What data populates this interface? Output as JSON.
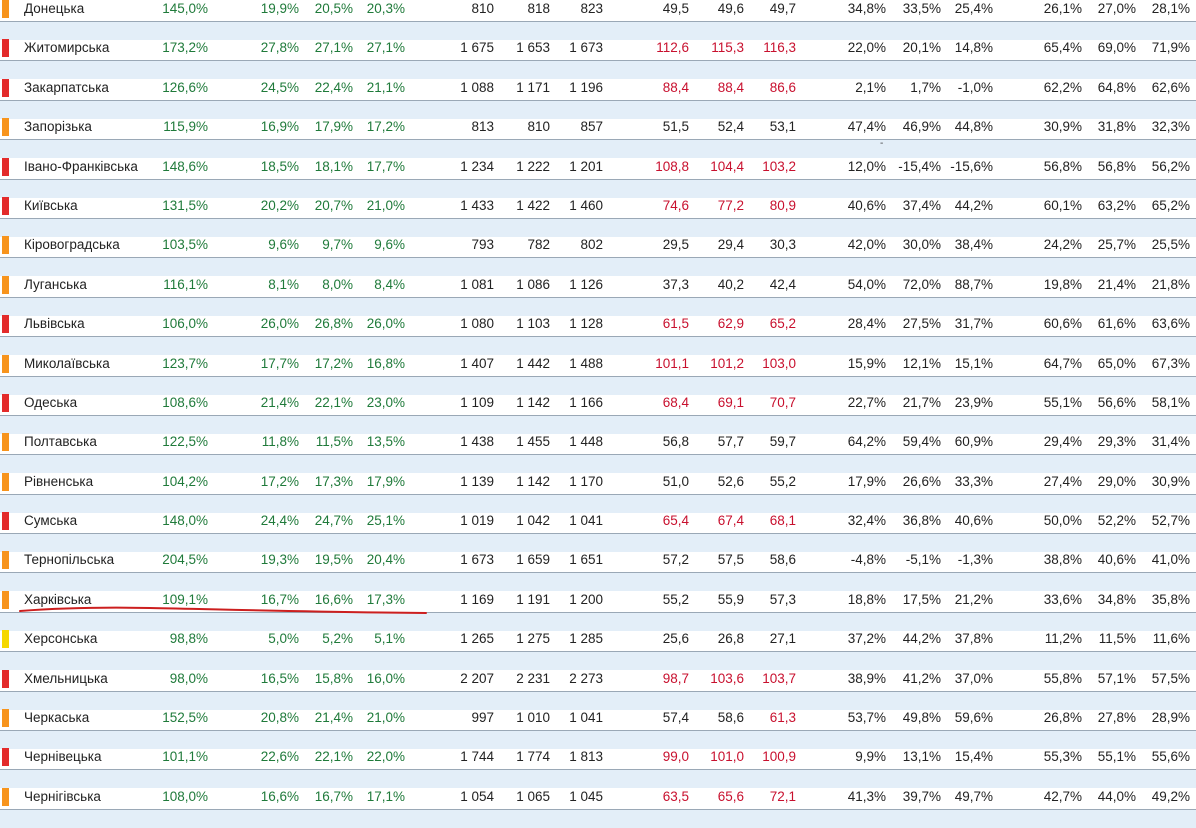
{
  "colors": {
    "orange": "#f7941d",
    "red": "#e32b2b",
    "yellow": "#f5d800",
    "green_text": "#1f7a3a",
    "red_text": "#c8102e",
    "band": "#e3eef8",
    "underline": "#cc1f1f"
  },
  "rows": [
    {
      "marker": "orange",
      "name": "Донецька",
      "p": "145,0%",
      "g": [
        "19,9%",
        "20,5%",
        "20,3%"
      ],
      "n": [
        "810",
        "818",
        "823"
      ],
      "v": [
        "49,5",
        "49,6",
        "49,7"
      ],
      "vc": "dark",
      "q": [
        "34,8%",
        "33,5%",
        "25,4%"
      ],
      "s": [
        "26,1%",
        "27,0%",
        "28,1%"
      ]
    },
    {
      "marker": "red",
      "name": "Житомирська",
      "p": "173,2%",
      "g": [
        "27,8%",
        "27,1%",
        "27,1%"
      ],
      "n": [
        "1 675",
        "1 653",
        "1 673"
      ],
      "v": [
        "112,6",
        "115,3",
        "116,3"
      ],
      "vc": "red",
      "q": [
        "22,0%",
        "20,1%",
        "14,8%"
      ],
      "s": [
        "65,4%",
        "69,0%",
        "71,9%"
      ]
    },
    {
      "marker": "red",
      "name": "Закарпатська",
      "p": "126,6%",
      "g": [
        "24,5%",
        "22,4%",
        "21,1%"
      ],
      "n": [
        "1 088",
        "1 171",
        "1 196"
      ],
      "v": [
        "88,4",
        "88,4",
        "86,6"
      ],
      "vc": "red",
      "q": [
        "2,1%",
        "1,7%",
        "-1,0%"
      ],
      "s": [
        "62,2%",
        "64,8%",
        "62,6%"
      ]
    },
    {
      "marker": "orange",
      "name": "Запорізька",
      "p": "115,9%",
      "g": [
        "16,9%",
        "17,9%",
        "17,2%"
      ],
      "n": [
        "813",
        "810",
        "857"
      ],
      "v": [
        "51,5",
        "52,4",
        "53,1"
      ],
      "vc": "dark",
      "q": [
        "47,4%",
        "46,9%",
        "44,8%"
      ],
      "s": [
        "30,9%",
        "31,8%",
        "32,3%"
      ],
      "dash": "-"
    },
    {
      "marker": "red",
      "name": "Івано-Франківська",
      "p": "148,6%",
      "g": [
        "18,5%",
        "18,1%",
        "17,7%"
      ],
      "n": [
        "1 234",
        "1 222",
        "1 201"
      ],
      "v": [
        "108,8",
        "104,4",
        "103,2"
      ],
      "vc": "red",
      "q": [
        "12,0%",
        "-15,4%",
        "-15,6%"
      ],
      "s": [
        "56,8%",
        "56,8%",
        "56,2%"
      ]
    },
    {
      "marker": "red",
      "name": "Київська",
      "p": "131,5%",
      "g": [
        "20,2%",
        "20,7%",
        "21,0%"
      ],
      "n": [
        "1 433",
        "1 422",
        "1 460"
      ],
      "v": [
        "74,6",
        "77,2",
        "80,9"
      ],
      "vc": "red",
      "q": [
        "40,6%",
        "37,4%",
        "44,2%"
      ],
      "s": [
        "60,1%",
        "63,2%",
        "65,2%"
      ]
    },
    {
      "marker": "orange",
      "name": "Кіровоградська",
      "p": "103,5%",
      "g": [
        "9,6%",
        "9,7%",
        "9,6%"
      ],
      "n": [
        "793",
        "782",
        "802"
      ],
      "v": [
        "29,5",
        "29,4",
        "30,3"
      ],
      "vc": "dark",
      "q": [
        "42,0%",
        "30,0%",
        "38,4%"
      ],
      "s": [
        "24,2%",
        "25,7%",
        "25,5%"
      ]
    },
    {
      "marker": "orange",
      "name": "Луганська",
      "p": "116,1%",
      "g": [
        "8,1%",
        "8,0%",
        "8,4%"
      ],
      "n": [
        "1 081",
        "1 086",
        "1 126"
      ],
      "v": [
        "37,3",
        "40,2",
        "42,4"
      ],
      "vc": "dark",
      "q": [
        "54,0%",
        "72,0%",
        "88,7%"
      ],
      "s": [
        "19,8%",
        "21,4%",
        "21,8%"
      ]
    },
    {
      "marker": "red",
      "name": "Львівська",
      "p": "106,0%",
      "g": [
        "26,0%",
        "26,8%",
        "26,0%"
      ],
      "n": [
        "1 080",
        "1 103",
        "1 128"
      ],
      "v": [
        "61,5",
        "62,9",
        "65,2"
      ],
      "vc": "red",
      "q": [
        "28,4%",
        "27,5%",
        "31,7%"
      ],
      "s": [
        "60,6%",
        "61,6%",
        "63,6%"
      ]
    },
    {
      "marker": "orange",
      "name": "Миколаївська",
      "p": "123,7%",
      "g": [
        "17,7%",
        "17,2%",
        "16,8%"
      ],
      "n": [
        "1 407",
        "1 442",
        "1 488"
      ],
      "v": [
        "101,1",
        "101,2",
        "103,0"
      ],
      "vc": "red",
      "q": [
        "15,9%",
        "12,1%",
        "15,1%"
      ],
      "s": [
        "64,7%",
        "65,0%",
        "67,3%"
      ]
    },
    {
      "marker": "red",
      "name": "Одеська",
      "p": "108,6%",
      "g": [
        "21,4%",
        "22,1%",
        "23,0%"
      ],
      "n": [
        "1 109",
        "1 142",
        "1 166"
      ],
      "v": [
        "68,4",
        "69,1",
        "70,7"
      ],
      "vc": "red",
      "q": [
        "22,7%",
        "21,7%",
        "23,9%"
      ],
      "s": [
        "55,1%",
        "56,6%",
        "58,1%"
      ]
    },
    {
      "marker": "orange",
      "name": "Полтавська",
      "p": "122,5%",
      "g": [
        "11,8%",
        "11,5%",
        "13,5%"
      ],
      "n": [
        "1 438",
        "1 455",
        "1 448"
      ],
      "v": [
        "56,8",
        "57,7",
        "59,7"
      ],
      "vc": "dark",
      "q": [
        "64,2%",
        "59,4%",
        "60,9%"
      ],
      "s": [
        "29,4%",
        "29,3%",
        "31,4%"
      ]
    },
    {
      "marker": "orange",
      "name": "Рівненська",
      "p": "104,2%",
      "g": [
        "17,2%",
        "17,3%",
        "17,9%"
      ],
      "n": [
        "1 139",
        "1 142",
        "1 170"
      ],
      "v": [
        "51,0",
        "52,6",
        "55,2"
      ],
      "vc": "dark",
      "q": [
        "17,9%",
        "26,6%",
        "33,3%"
      ],
      "s": [
        "27,4%",
        "29,0%",
        "30,9%"
      ]
    },
    {
      "marker": "red",
      "name": "Сумська",
      "p": "148,0%",
      "g": [
        "24,4%",
        "24,7%",
        "25,1%"
      ],
      "n": [
        "1 019",
        "1 042",
        "1 041"
      ],
      "v": [
        "65,4",
        "67,4",
        "68,1"
      ],
      "vc": "red",
      "q": [
        "32,4%",
        "36,8%",
        "40,6%"
      ],
      "s": [
        "50,0%",
        "52,2%",
        "52,7%"
      ]
    },
    {
      "marker": "orange",
      "name": "Тернопільська",
      "p": "204,5%",
      "g": [
        "19,3%",
        "19,5%",
        "20,4%"
      ],
      "n": [
        "1 673",
        "1 659",
        "1 651"
      ],
      "v": [
        "57,2",
        "57,5",
        "58,6"
      ],
      "vc": "dark",
      "q": [
        "-4,8%",
        "-5,1%",
        "-1,3%"
      ],
      "s": [
        "38,8%",
        "40,6%",
        "41,0%"
      ]
    },
    {
      "marker": "orange",
      "name": "Харківська",
      "p": "109,1%",
      "g": [
        "16,7%",
        "16,6%",
        "17,3%"
      ],
      "n": [
        "1 169",
        "1 191",
        "1 200"
      ],
      "v": [
        "55,2",
        "55,9",
        "57,3"
      ],
      "vc": "dark",
      "q": [
        "18,8%",
        "17,5%",
        "21,2%"
      ],
      "s": [
        "33,6%",
        "34,8%",
        "35,8%"
      ]
    },
    {
      "marker": "yellow",
      "name": "Херсонська",
      "p": "98,8%",
      "g": [
        "5,0%",
        "5,2%",
        "5,1%"
      ],
      "n": [
        "1 265",
        "1 275",
        "1 285"
      ],
      "v": [
        "25,6",
        "26,8",
        "27,1"
      ],
      "vc": "dark",
      "q": [
        "37,2%",
        "44,2%",
        "37,8%"
      ],
      "s": [
        "11,2%",
        "11,5%",
        "11,6%"
      ]
    },
    {
      "marker": "red",
      "name": "Хмельницька",
      "p": "98,0%",
      "g": [
        "16,5%",
        "15,8%",
        "16,0%"
      ],
      "n": [
        "2 207",
        "2 231",
        "2 273"
      ],
      "v": [
        "98,7",
        "103,6",
        "103,7"
      ],
      "vc": "red",
      "q": [
        "38,9%",
        "41,2%",
        "37,0%"
      ],
      "s": [
        "55,8%",
        "57,1%",
        "57,5%"
      ]
    },
    {
      "marker": "orange",
      "name": "Черкаська",
      "p": "152,5%",
      "g": [
        "20,8%",
        "21,4%",
        "21,0%"
      ],
      "n": [
        "997",
        "1 010",
        "1 041"
      ],
      "v": [
        "57,4",
        "58,6",
        "61,3"
      ],
      "vc": "mixed",
      "q": [
        "53,7%",
        "49,8%",
        "59,6%"
      ],
      "s": [
        "26,8%",
        "27,8%",
        "28,9%"
      ]
    },
    {
      "marker": "red",
      "name": "Чернівецька",
      "p": "101,1%",
      "g": [
        "22,6%",
        "22,1%",
        "22,0%"
      ],
      "n": [
        "1 744",
        "1 774",
        "1 813"
      ],
      "v": [
        "99,0",
        "101,0",
        "100,9"
      ],
      "vc": "red",
      "q": [
        "9,9%",
        "13,1%",
        "15,4%"
      ],
      "s": [
        "55,3%",
        "55,1%",
        "55,6%"
      ]
    },
    {
      "marker": "orange",
      "name": "Чернігівська",
      "p": "108,0%",
      "g": [
        "16,6%",
        "16,7%",
        "17,1%"
      ],
      "n": [
        "1 054",
        "1 065",
        "1 045"
      ],
      "v": [
        "63,5",
        "65,6",
        "72,1"
      ],
      "vc": "red",
      "q": [
        "41,3%",
        "39,7%",
        "49,7%"
      ],
      "s": [
        "42,7%",
        "44,0%",
        "49,2%"
      ]
    }
  ]
}
